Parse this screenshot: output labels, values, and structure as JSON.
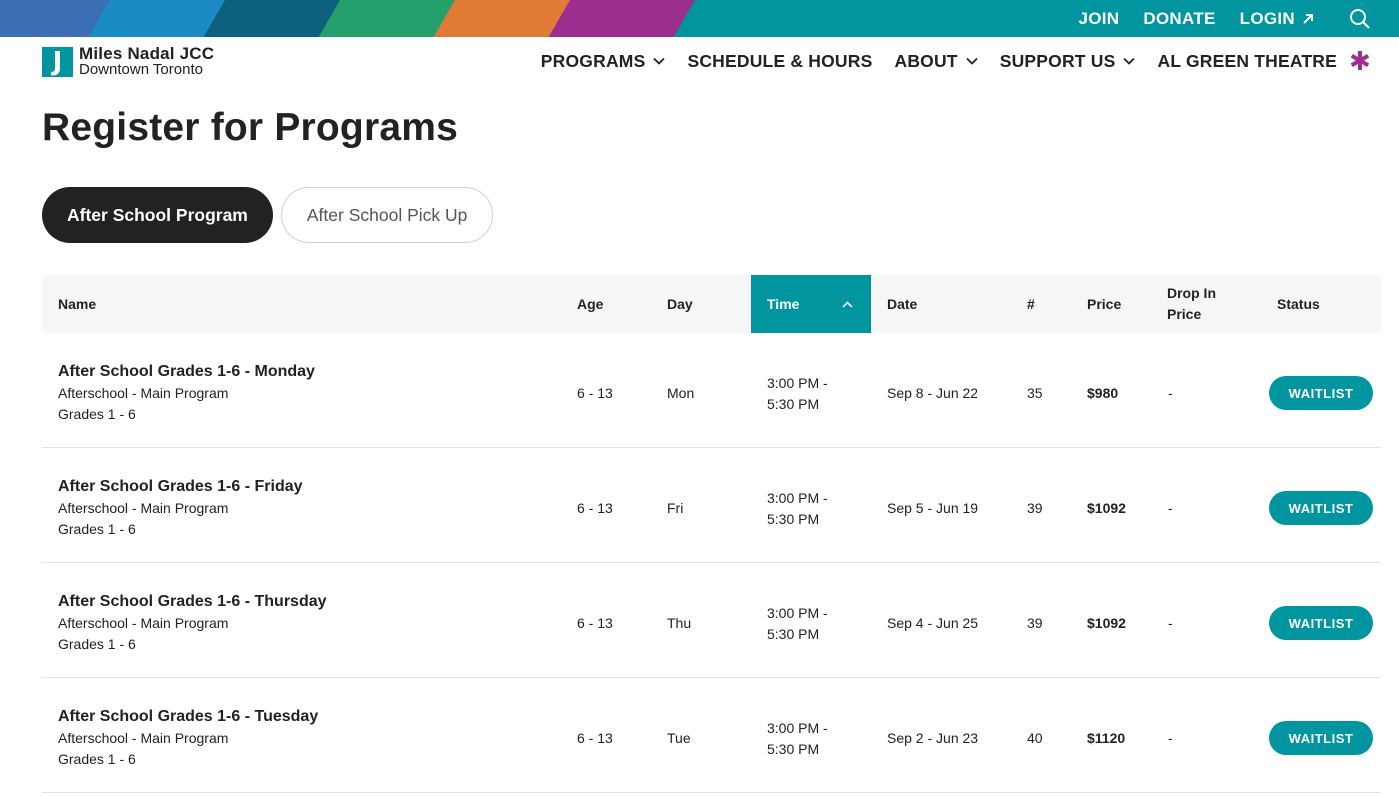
{
  "utility_nav": {
    "join": "JOIN",
    "donate": "DONATE",
    "login": "LOGIN",
    "login_icon": "arrow-up-right-icon",
    "search_icon": "search-icon"
  },
  "brand": {
    "mark": "J",
    "line1": "Miles Nadal JCC",
    "line2": "Downtown Toronto",
    "accent_color": "#00959f",
    "stripe_colors": [
      "#3a6fb4",
      "#1a8bc4",
      "#0c5f7d",
      "#23a06b",
      "#e07a35",
      "#9b2e8f"
    ]
  },
  "main_nav": {
    "programs": "PROGRAMS",
    "schedule": "SCHEDULE & HOURS",
    "about": "ABOUT",
    "support": "SUPPORT US",
    "theatre": "AL GREEN THEATRE",
    "theatre_mark": "✱"
  },
  "page": {
    "title": "Register for Programs"
  },
  "tabs": [
    {
      "label": "After School Program",
      "active": true
    },
    {
      "label": "After School Pick Up",
      "active": false
    }
  ],
  "table": {
    "headers": {
      "name": "Name",
      "age": "Age",
      "day": "Day",
      "time": "Time",
      "date": "Date",
      "count": "#",
      "price": "Price",
      "drop_in_line1": "Drop In",
      "drop_in_line2": "Price",
      "status": "Status"
    },
    "sort": {
      "column": "Time",
      "direction": "ascending"
    },
    "rows": [
      {
        "title": "After School Grades 1-6 - Monday",
        "category": "Afterschool - Main Program",
        "grades": "Grades 1 - 6",
        "age": "6 - 13",
        "day": "Mon",
        "time_start": "3:00 PM -",
        "time_end": "5:30 PM",
        "date": "Sep 8 - Jun 22",
        "count": "35",
        "price": "$980",
        "drop_in": "-",
        "status": "WAITLIST"
      },
      {
        "title": "After School Grades 1-6 - Friday",
        "category": "Afterschool - Main Program",
        "grades": "Grades 1 - 6",
        "age": "6 - 13",
        "day": "Fri",
        "time_start": "3:00 PM -",
        "time_end": "5:30 PM",
        "date": "Sep 5 - Jun 19",
        "count": "39",
        "price": "$1092",
        "drop_in": "-",
        "status": "WAITLIST"
      },
      {
        "title": "After School Grades 1-6 - Thursday",
        "category": "Afterschool - Main Program",
        "grades": "Grades 1 - 6",
        "age": "6 - 13",
        "day": "Thu",
        "time_start": "3:00 PM -",
        "time_end": "5:30 PM",
        "date": "Sep 4 - Jun 25",
        "count": "39",
        "price": "$1092",
        "drop_in": "-",
        "status": "WAITLIST"
      },
      {
        "title": "After School Grades 1-6 - Tuesday",
        "category": "Afterschool - Main Program",
        "grades": "Grades 1 - 6",
        "age": "6 - 13",
        "day": "Tue",
        "time_start": "3:00 PM -",
        "time_end": "5:30 PM",
        "date": "Sep 2 - Jun 23",
        "count": "40",
        "price": "$1120",
        "drop_in": "-",
        "status": "WAITLIST"
      }
    ]
  }
}
